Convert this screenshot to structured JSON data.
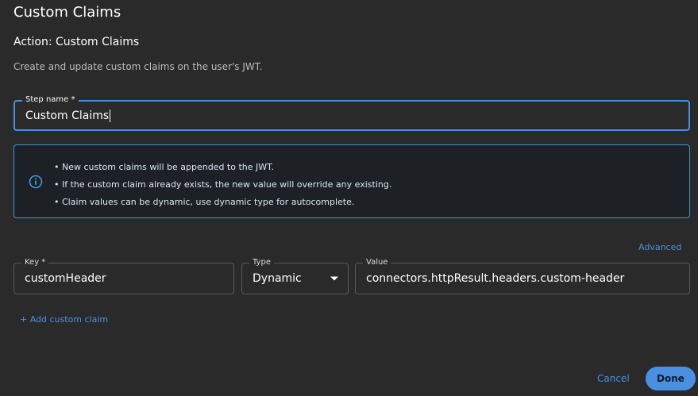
{
  "dialog": {
    "title": "Custom Claims",
    "action_title": "Action: Custom Claims",
    "description": "Create and update custom claims on the user's JWT."
  },
  "step_name": {
    "label": "Step name *",
    "value": "Custom Claims"
  },
  "info": {
    "icon": "info-icon",
    "items": [
      "New custom claims will be appended to the JWT.",
      "If the custom claim already exists, the new value will override any existing.",
      "Claim values can be dynamic, use dynamic type for autocomplete."
    ]
  },
  "advanced_label": "Advanced",
  "claim": {
    "key_label": "Key *",
    "key_value": "customHeader",
    "type_label": "Type",
    "type_value": "Dynamic",
    "value_label": "Value",
    "value_value": "connectors.httpResult.headers.custom-header"
  },
  "add_claim_label": "+ Add custom claim",
  "actions": {
    "cancel_label": "Cancel",
    "done_label": "Done"
  },
  "colors": {
    "background": "#2a2a2a",
    "accent": "#4a90e2",
    "info_border": "#3b9ad6"
  }
}
